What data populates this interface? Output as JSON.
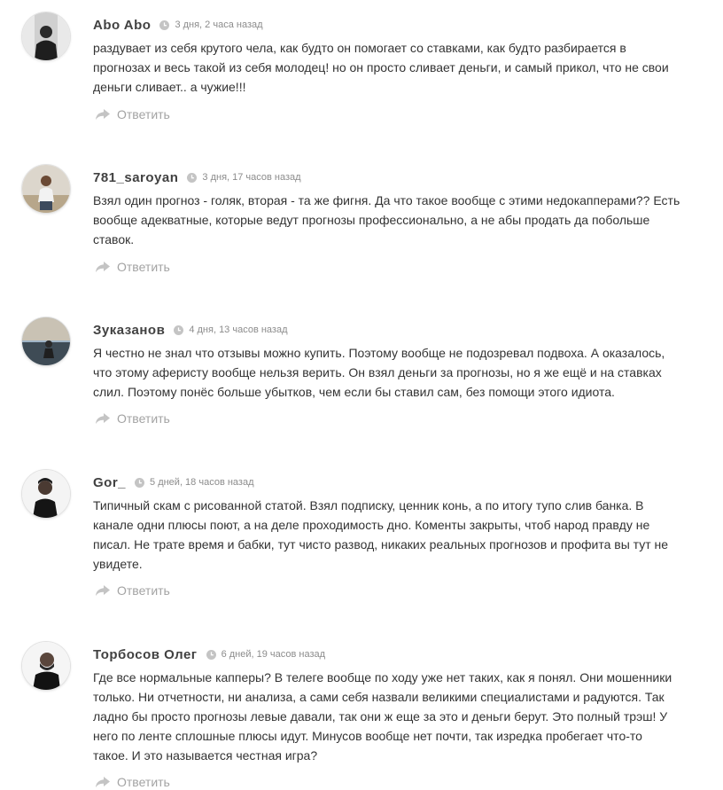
{
  "comments": [
    {
      "author": "Abo Abo",
      "date": "3 дня, 2 часа назад",
      "lines": [
        "раздувает из себя крутого чела, как будто он помогает со ставками, как будто разбирается в",
        "прогнозах и весь такой из себя молодец! но он просто сливает деньги, и самый прикол, что не свои",
        "деньги сливает.. а чужие!!!"
      ],
      "reply_label": "Ответить"
    },
    {
      "author": "781_saroyan",
      "date": "3 дня, 17 часов назад",
      "lines": [
        "Взял один прогноз - голяк, вторая - та же фигня. Да что такое вообще с этими недокапперами?? Есть",
        "вообще адекватные, которые ведут прогнозы профессионально, а не абы продать да побольше",
        "ставок."
      ],
      "reply_label": "Ответить"
    },
    {
      "author": "Зуказанов",
      "date": "4 дня, 13 часов назад",
      "lines": [
        "Я честно не знал что отзывы можно купить. Поэтому вообще не подозревал подвоха. А оказалось,",
        "что этому аферисту вообще нельзя верить. Он взял деньги за прогнозы, но я же ещё и на ставках",
        "слил. Поэтому понёс больше убытков, чем если бы ставил сам, без помощи этого идиота."
      ],
      "reply_label": "Ответить"
    },
    {
      "author": "Gor_",
      "date": "5 дней, 18 часов назад",
      "lines": [
        "Типичный скам с рисованной статой. Взял подписку, ценник конь, а по итогу тупо слив банка. В",
        "канале одни плюсы поют, а на деле проходимость дно. Коменты закрыты, чтоб народ правду не",
        "писал. Не трате время и бабки, тут чисто развод, никаких реальных прогнозов и профита вы тут не",
        "увидете."
      ],
      "reply_label": "Ответить"
    },
    {
      "author": "Торбосов Олег",
      "date": "6 дней, 19 часов назад",
      "lines": [
        "Где все нормальные капперы? В телеге вообще по ходу уже нет таких, как я понял. Они мошенники",
        "только. Ни отчетности, ни анализа, а сами себя назвали великими специалистами и радуются. Так",
        "ладно бы просто прогнозы левые давали, так они ж еще за это и деньги берут. Это полный трэш! У",
        "него по ленте сплошные плюсы идут. Минусов вообще нет почти, так изредка пробегает что-то",
        "такое. И это называется честная игра?"
      ],
      "reply_label": "Ответить"
    }
  ],
  "icons": {
    "clock": "clock-icon",
    "reply": "reply-icon"
  },
  "colors": {
    "author": "#414141",
    "date": "#8c8c8c",
    "reply": "#a3a3a3",
    "icon": "#c4c4c4"
  }
}
